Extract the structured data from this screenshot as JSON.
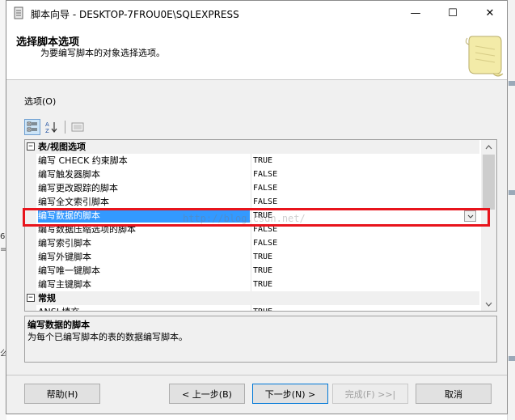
{
  "window": {
    "title": "脚本向导 - DESKTOP-7FROU0E\\SQLEXPRESS",
    "minimize": "—",
    "maximize": "☐",
    "close": "✕"
  },
  "header": {
    "title": "选择脚本选项",
    "subtitle": "为要编写脚本的对象选择选项。"
  },
  "options_label": "选项(O)",
  "grid": {
    "rows": [
      {
        "kind": "category",
        "name": "表/视图选项",
        "toggle": "−"
      },
      {
        "kind": "item",
        "name": "编写 CHECK 约束脚本",
        "value": "TRUE"
      },
      {
        "kind": "item",
        "name": "编写触发器脚本",
        "value": "FALSE"
      },
      {
        "kind": "item",
        "name": "编写更改跟踪的脚本",
        "value": "FALSE"
      },
      {
        "kind": "item",
        "name": "编写全文索引脚本",
        "value": "FALSE"
      },
      {
        "kind": "selected",
        "name": "编写数据的脚本",
        "value": "TRUE"
      },
      {
        "kind": "item",
        "name": "编写数据压缩选项的脚本",
        "value": "FALSE"
      },
      {
        "kind": "item",
        "name": "编写索引脚本",
        "value": "FALSE"
      },
      {
        "kind": "item",
        "name": "编写外键脚本",
        "value": "TRUE"
      },
      {
        "kind": "item",
        "name": "编写唯一键脚本",
        "value": "TRUE"
      },
      {
        "kind": "item",
        "name": "编写主键脚本",
        "value": "TRUE"
      },
      {
        "kind": "category",
        "name": "常规",
        "toggle": "−"
      },
      {
        "kind": "item",
        "name": "ANSI 填充",
        "value": "TRUE"
      }
    ],
    "watermark": "http://blog.csdn.net/"
  },
  "description": {
    "title": "编写数据的脚本",
    "text": "为每个已编写脚本的表的数据编写脚本。"
  },
  "buttons": {
    "help": "帮助(H)",
    "back": "< 上一步(B)",
    "next": "下一步(N) >",
    "finish": "完成(F) >>|",
    "cancel": "取消"
  },
  "colors": {
    "selection": "#3399ff",
    "highlight_box": "#e8141c",
    "primary_border": "#0078d7"
  }
}
